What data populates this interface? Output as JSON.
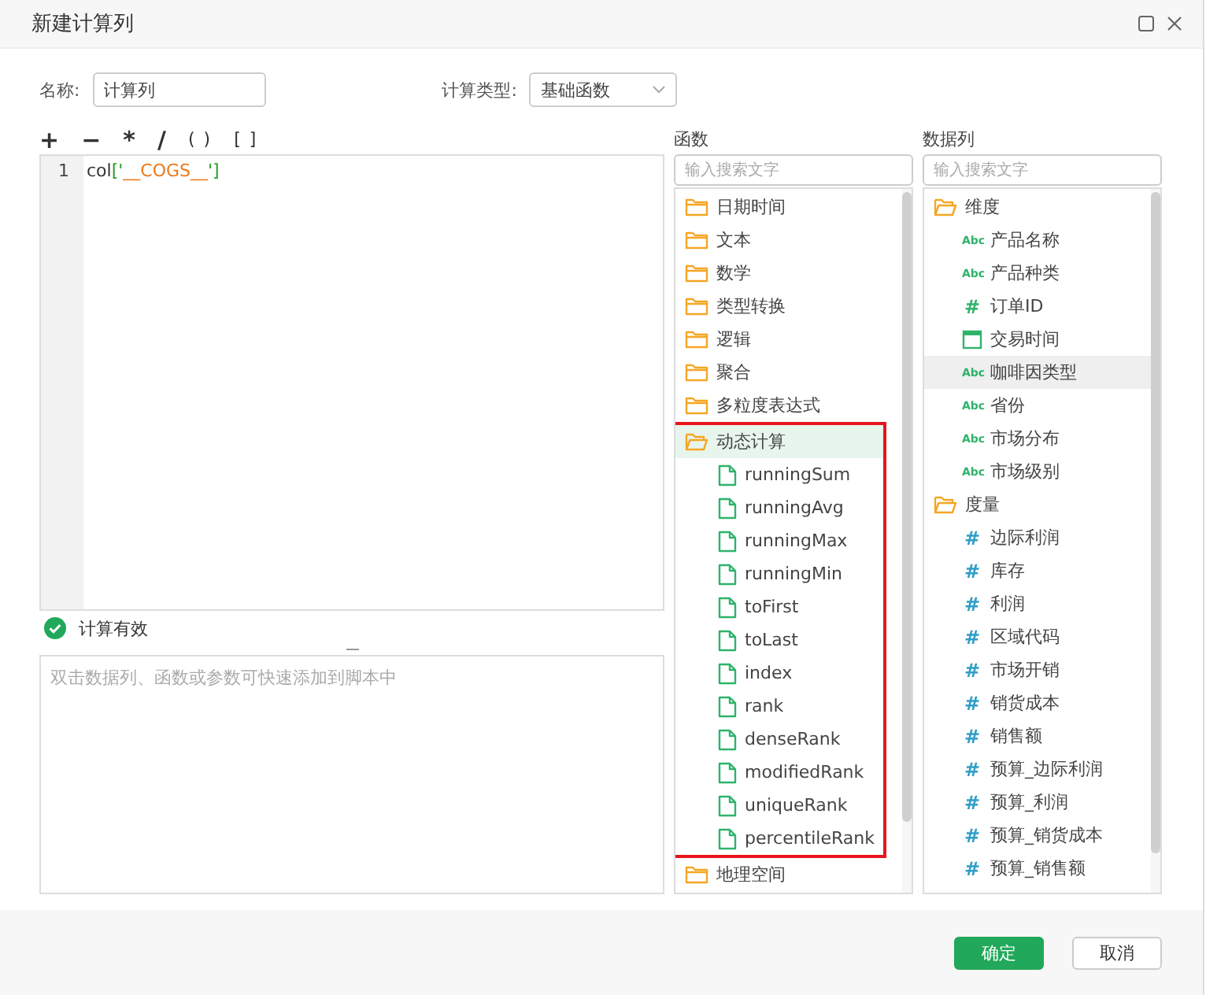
{
  "window": {
    "title": "新建计算列"
  },
  "name_field": {
    "label": "名称:",
    "value": "计算列"
  },
  "calc_type": {
    "label": "计算类型:",
    "value": "基础函数"
  },
  "operators": [
    "+",
    "−",
    "*",
    "/",
    "( )",
    "[ ]"
  ],
  "editor": {
    "lines": [
      {
        "number": "1",
        "tokens": [
          {
            "kind": "plain",
            "text": "col"
          },
          {
            "kind": "bracket",
            "text": "['"
          },
          {
            "kind": "string",
            "text": "__COGS__"
          },
          {
            "kind": "bracket",
            "text": "']"
          }
        ]
      }
    ]
  },
  "status": {
    "valid": true,
    "text": "计算有效"
  },
  "hint": {
    "placeholder": "双击数据列、函数或参数可快速添加到脚本中"
  },
  "functions": {
    "title": "函数",
    "search": {
      "placeholder": "输入搜索文字"
    },
    "tree": [
      {
        "kind": "folder",
        "label": "日期时间",
        "expanded": false,
        "selected": false
      },
      {
        "kind": "folder",
        "label": "文本",
        "expanded": false,
        "selected": false
      },
      {
        "kind": "folder",
        "label": "数学",
        "expanded": false,
        "selected": false
      },
      {
        "kind": "folder",
        "label": "类型转换",
        "expanded": false,
        "selected": false
      },
      {
        "kind": "folder",
        "label": "逻辑",
        "expanded": false,
        "selected": false
      },
      {
        "kind": "folder",
        "label": "聚合",
        "expanded": false,
        "selected": false
      },
      {
        "kind": "folder",
        "label": "多粒度表达式",
        "expanded": false,
        "selected": false
      },
      {
        "kind": "folder",
        "label": "动态计算",
        "expanded": true,
        "selected": true,
        "outlined": true,
        "children": [
          {
            "kind": "function",
            "label": "runningSum",
            "selected": false
          },
          {
            "kind": "function",
            "label": "runningAvg",
            "selected": false
          },
          {
            "kind": "function",
            "label": "runningMax",
            "selected": false
          },
          {
            "kind": "function",
            "label": "runningMin",
            "selected": false
          },
          {
            "kind": "function",
            "label": "toFirst",
            "selected": false
          },
          {
            "kind": "function",
            "label": "toLast",
            "selected": false
          },
          {
            "kind": "function",
            "label": "index",
            "selected": false
          },
          {
            "kind": "function",
            "label": "rank",
            "selected": false
          },
          {
            "kind": "function",
            "label": "denseRank",
            "selected": false
          },
          {
            "kind": "function",
            "label": "modifiedRank",
            "selected": false
          },
          {
            "kind": "function",
            "label": "uniqueRank",
            "selected": false
          },
          {
            "kind": "function",
            "label": "percentileRank",
            "selected": false
          }
        ]
      },
      {
        "kind": "folder",
        "label": "地理空间",
        "expanded": false,
        "selected": false
      }
    ]
  },
  "data_columns": {
    "title": "数据列",
    "search": {
      "placeholder": "输入搜索文字"
    },
    "tree": [
      {
        "kind": "folder",
        "label": "维度",
        "expanded": true,
        "selected": false,
        "children": [
          {
            "kind": "text",
            "icon": "Abc",
            "label": "产品名称",
            "selected": false
          },
          {
            "kind": "text",
            "icon": "Abc",
            "label": "产品种类",
            "selected": false
          },
          {
            "kind": "id",
            "icon": "#",
            "label": "订单ID",
            "selected": false
          },
          {
            "kind": "date",
            "label": "交易时间",
            "selected": false
          },
          {
            "kind": "text",
            "icon": "Abc",
            "label": "咖啡因类型",
            "selected": true
          },
          {
            "kind": "text",
            "icon": "Abc",
            "label": "省份",
            "selected": false
          },
          {
            "kind": "text",
            "icon": "Abc",
            "label": "市场分布",
            "selected": false
          },
          {
            "kind": "text",
            "icon": "Abc",
            "label": "市场级别",
            "selected": false
          }
        ]
      },
      {
        "kind": "folder",
        "label": "度量",
        "expanded": true,
        "selected": false,
        "children": [
          {
            "kind": "measure",
            "icon": "#",
            "label": "边际利润",
            "selected": false
          },
          {
            "kind": "measure",
            "icon": "#",
            "label": "库存",
            "selected": false
          },
          {
            "kind": "measure",
            "icon": "#",
            "label": "利润",
            "selected": false
          },
          {
            "kind": "measure",
            "icon": "#",
            "label": "区域代码",
            "selected": false
          },
          {
            "kind": "measure",
            "icon": "#",
            "label": "市场开销",
            "selected": false
          },
          {
            "kind": "measure",
            "icon": "#",
            "label": "销货成本",
            "selected": false
          },
          {
            "kind": "measure",
            "icon": "#",
            "label": "销售额",
            "selected": false
          },
          {
            "kind": "measure",
            "icon": "#",
            "label": "预算_边际利润",
            "selected": false
          },
          {
            "kind": "measure",
            "icon": "#",
            "label": "预算_利润",
            "selected": false
          },
          {
            "kind": "measure",
            "icon": "#",
            "label": "预算_销货成本",
            "selected": false
          },
          {
            "kind": "measure",
            "icon": "#",
            "label": "预算_销售额",
            "selected": false
          }
        ]
      }
    ]
  },
  "buttons": [
    {
      "label": "确定",
      "kind": "primary"
    },
    {
      "label": "取消",
      "kind": "secondary"
    }
  ]
}
